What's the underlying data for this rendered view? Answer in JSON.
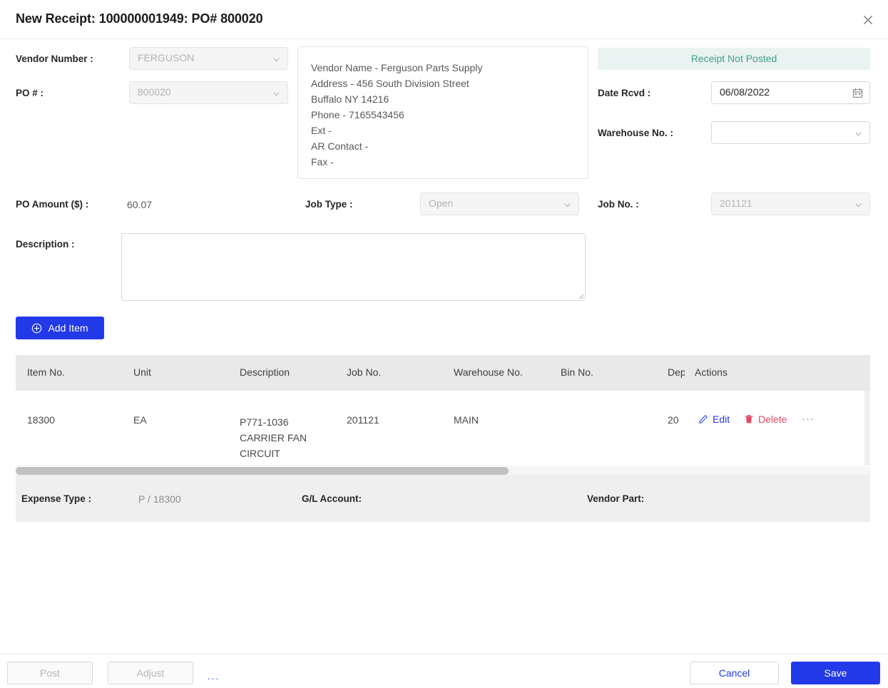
{
  "window": {
    "title": "New Receipt: 100000001949: PO# 800020",
    "close_icon": "close-icon"
  },
  "colors": {
    "primary": "#2239e8",
    "danger": "#e8485f",
    "status_text": "#3f9e8c",
    "status_bg": "#eaf3f1",
    "header_bg": "#e9e9e9",
    "footer_bg": "#efefef"
  },
  "form": {
    "vendor_number": {
      "label": "Vendor Number :",
      "value": "FERGUSON",
      "disabled": true
    },
    "po_number": {
      "label": "PO # :",
      "value": "800020",
      "disabled": true
    },
    "po_amount": {
      "label": "PO Amount ($) :",
      "value": "60.07"
    },
    "job_type": {
      "label": "Job Type :",
      "value": "Open",
      "disabled": true
    },
    "job_no": {
      "label": "Job No. :",
      "value": "201121",
      "disabled": true
    },
    "date_rcvd": {
      "label": "Date Rcvd :",
      "value": "06/08/2022",
      "icon": "calendar-icon"
    },
    "warehouse_no": {
      "label": "Warehouse No. :",
      "value": "",
      "placeholder": ""
    },
    "description": {
      "label": "Description :",
      "value": "",
      "placeholder": ""
    }
  },
  "status_banner": {
    "text": "Receipt Not Posted"
  },
  "vendor_card": {
    "lines": [
      "Vendor Name - Ferguson Parts Supply",
      "Address - 456 South Division Street",
      "Buffalo NY 14216",
      "Phone - 7165543456",
      "Ext -",
      "AR Contact -",
      "Fax -"
    ]
  },
  "toolbar": {
    "add_item_label": "Add Item",
    "add_item_icon": "plus-circle-icon"
  },
  "table": {
    "columns": [
      {
        "key": "item_no",
        "label": "Item No."
      },
      {
        "key": "unit",
        "label": "Unit"
      },
      {
        "key": "description",
        "label": "Description"
      },
      {
        "key": "job_no",
        "label": "Job No."
      },
      {
        "key": "warehouse_no",
        "label": "Warehouse No."
      },
      {
        "key": "bin_no",
        "label": "Bin No."
      },
      {
        "key": "dept",
        "label": "Dep"
      },
      {
        "key": "actions",
        "label": "Actions"
      }
    ],
    "rows": [
      {
        "item_no": "18300",
        "unit": "EA",
        "description": "P771-1036 CARRIER FAN CIRCUIT",
        "job_no": "201121",
        "warehouse_no": "MAIN",
        "bin_no": "",
        "dept": "20",
        "actions": {
          "edit_label": "Edit",
          "edit_icon": "pencil-icon",
          "delete_label": "Delete",
          "delete_icon": "trash-icon",
          "more_label": "···",
          "more_icon": "ellipsis-icon"
        }
      }
    ],
    "expanded_row": {
      "expense_type_label": "Expense Type :",
      "expense_type_value": "P / 18300",
      "gl_account_label": "G/L Account:",
      "gl_account_value": "",
      "vendor_part_label": "Vendor Part:",
      "vendor_part_value": ""
    }
  },
  "footer": {
    "post_label": "Post",
    "adjust_label": "Adjust",
    "more_label": "···",
    "cancel_label": "Cancel",
    "save_label": "Save"
  }
}
